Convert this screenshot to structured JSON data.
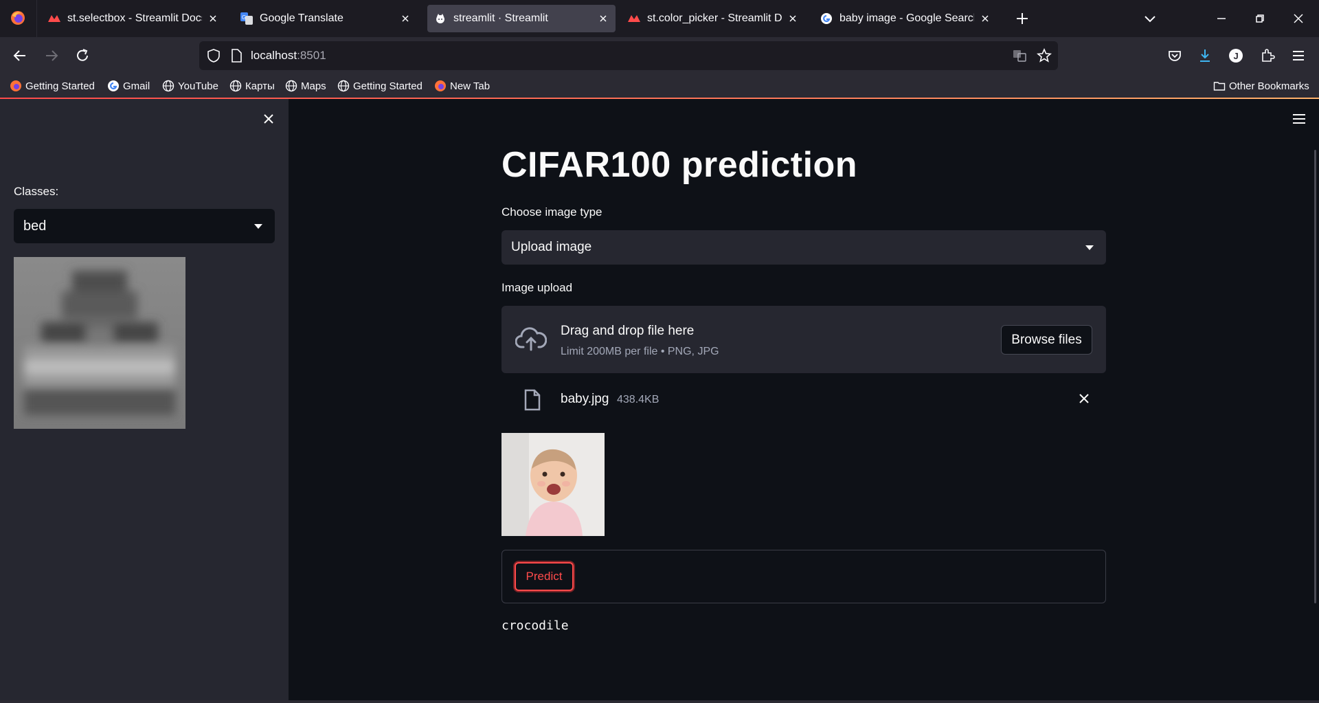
{
  "browser": {
    "tabs": [
      {
        "title": "st.selectbox - Streamlit Docs",
        "favicon": "streamlit-crown-icon",
        "active": false
      },
      {
        "title": "Google Translate",
        "favicon": "google-translate-icon",
        "active": false
      },
      {
        "title": "streamlit · Streamlit",
        "favicon": "github-icon",
        "active": true
      },
      {
        "title": "st.color_picker - Streamlit Docs",
        "favicon": "streamlit-crown-icon",
        "active": false
      },
      {
        "title": "baby image - Google Search",
        "favicon": "google-icon",
        "active": false
      }
    ],
    "url": {
      "host": "localhost",
      "port": ":8501"
    },
    "bookmarks": [
      {
        "label": "Getting Started",
        "icon": "firefox-icon"
      },
      {
        "label": "Gmail",
        "icon": "google-icon"
      },
      {
        "label": "YouTube",
        "icon": "globe-icon"
      },
      {
        "label": "Карты",
        "icon": "globe-icon"
      },
      {
        "label": "Maps",
        "icon": "globe-icon"
      },
      {
        "label": "Getting Started",
        "icon": "globe-icon"
      },
      {
        "label": "New Tab",
        "icon": "firefox-icon"
      }
    ],
    "other_bookmarks": "Other Bookmarks",
    "colors": {
      "accent": "#ff4b4b",
      "download": "#3fb6f2"
    }
  },
  "sidebar": {
    "classes_label": "Classes:",
    "classes_value": "bed"
  },
  "main": {
    "title": "CIFAR100 prediction",
    "image_type_label": "Choose image type",
    "image_type_value": "Upload image",
    "upload_label": "Image upload",
    "drag_text": "Drag and drop file here",
    "limit_text": "Limit 200MB per file • PNG, JPG",
    "browse_label": "Browse files",
    "file": {
      "name": "baby.jpg",
      "size": "438.4KB"
    },
    "predict_label": "Predict",
    "result": "crocodile"
  }
}
